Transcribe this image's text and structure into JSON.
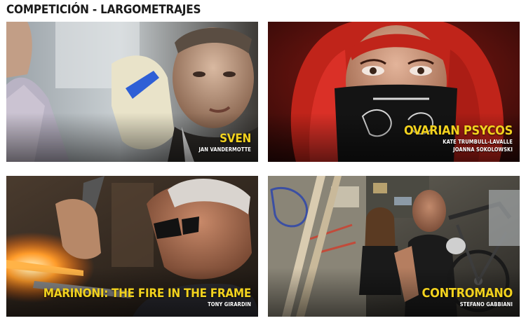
{
  "section": {
    "title": "COMPETICIÓN - LARGOMETRAJES"
  },
  "films": [
    {
      "title": "SVEN",
      "directors": [
        "JAN VANDERMOTTE"
      ]
    },
    {
      "title": "OVARIAN PSYCOS",
      "directors": [
        "KATE TRUMBULL-LAVALLE",
        "JOANNA SOKOLOWSKI"
      ]
    },
    {
      "title": "MARINONI: THE FIRE IN THE FRAME",
      "directors": [
        "TONY GIRARDIN"
      ]
    },
    {
      "title": "CONTROMANO",
      "directors": [
        "STEFANO GABBIANI"
      ]
    }
  ],
  "colors": {
    "title_accent": "#f2d21e",
    "director_text": "#ffffff",
    "heading_text": "#1a1a1a"
  }
}
